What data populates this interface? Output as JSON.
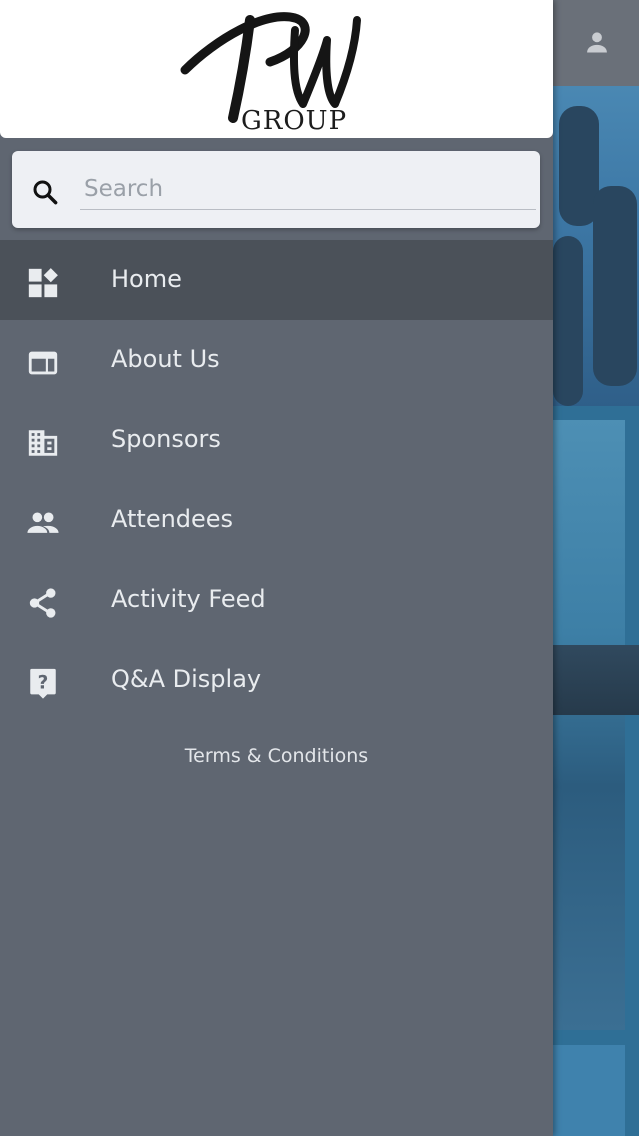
{
  "header": {
    "logo_text": "PW",
    "logo_subtext": "GROUP",
    "user_icon": "person-icon"
  },
  "search": {
    "placeholder": "Search",
    "value": "",
    "icon": "search-icon"
  },
  "menu": {
    "items": [
      {
        "label": "Home",
        "icon": "dashboard-icon",
        "active": true
      },
      {
        "label": "About Us",
        "icon": "web-page-icon",
        "active": false
      },
      {
        "label": "Sponsors",
        "icon": "building-icon",
        "active": false
      },
      {
        "label": "Attendees",
        "icon": "people-icon",
        "active": false
      },
      {
        "label": "Activity Feed",
        "icon": "share-icon",
        "active": false
      },
      {
        "label": "Q&A Display",
        "icon": "question-answer-icon",
        "active": false
      }
    ]
  },
  "footer": {
    "terms_label": "Terms & Conditions"
  },
  "colors": {
    "drawer_bg": "#5f6671",
    "active_item_bg": "#4b5159",
    "text": "#e9ecef",
    "logo_accent": "#e8731f"
  }
}
